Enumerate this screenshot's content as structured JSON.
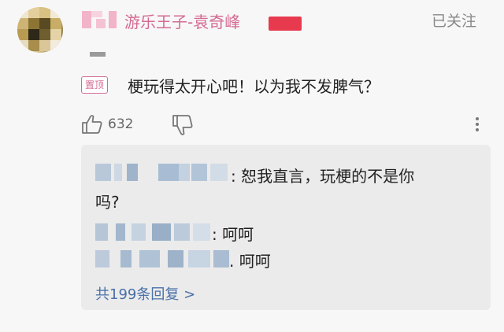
{
  "comment": {
    "username": "游乐王子-袁奇峰",
    "follow_label": "已关注",
    "pin_label": "置顶",
    "text": "梗玩得太开心吧！以为我不发脾气？",
    "like_count": "632"
  },
  "replies": [
    {
      "text_line1": ": 恕我直言，玩梗的不是你",
      "text_line2": "吗?"
    },
    {
      "text_line1": ": 呵呵"
    },
    {
      "text_line1": ". 呵呵"
    }
  ],
  "more_replies_label": "共199条回复 >",
  "icons": {
    "like": "thumbs-up-icon",
    "dislike": "thumbs-down-icon",
    "more": "more-vertical-icon"
  },
  "colors": {
    "username": "#d46a93",
    "link": "#4a70a8",
    "badge": "#e83a4e"
  }
}
